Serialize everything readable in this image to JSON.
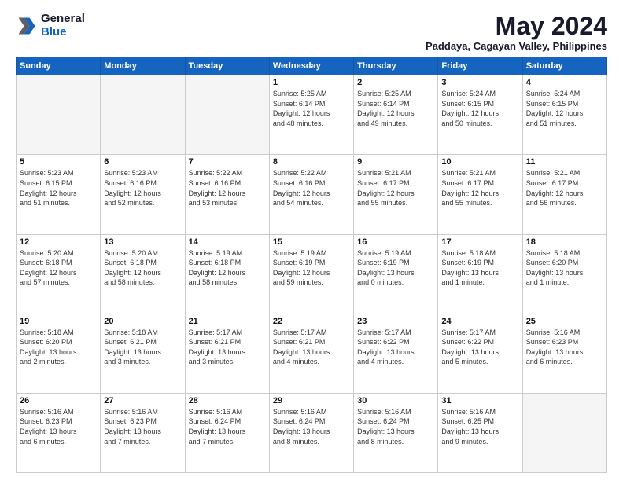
{
  "logo": {
    "general": "General",
    "blue": "Blue"
  },
  "header": {
    "month": "May 2024",
    "location": "Paddaya, Cagayan Valley, Philippines"
  },
  "weekdays": [
    "Sunday",
    "Monday",
    "Tuesday",
    "Wednesday",
    "Thursday",
    "Friday",
    "Saturday"
  ],
  "weeks": [
    [
      {
        "day": "",
        "info": ""
      },
      {
        "day": "",
        "info": ""
      },
      {
        "day": "",
        "info": ""
      },
      {
        "day": "1",
        "info": "Sunrise: 5:25 AM\nSunset: 6:14 PM\nDaylight: 12 hours\nand 48 minutes."
      },
      {
        "day": "2",
        "info": "Sunrise: 5:25 AM\nSunset: 6:14 PM\nDaylight: 12 hours\nand 49 minutes."
      },
      {
        "day": "3",
        "info": "Sunrise: 5:24 AM\nSunset: 6:15 PM\nDaylight: 12 hours\nand 50 minutes."
      },
      {
        "day": "4",
        "info": "Sunrise: 5:24 AM\nSunset: 6:15 PM\nDaylight: 12 hours\nand 51 minutes."
      }
    ],
    [
      {
        "day": "5",
        "info": "Sunrise: 5:23 AM\nSunset: 6:15 PM\nDaylight: 12 hours\nand 51 minutes."
      },
      {
        "day": "6",
        "info": "Sunrise: 5:23 AM\nSunset: 6:16 PM\nDaylight: 12 hours\nand 52 minutes."
      },
      {
        "day": "7",
        "info": "Sunrise: 5:22 AM\nSunset: 6:16 PM\nDaylight: 12 hours\nand 53 minutes."
      },
      {
        "day": "8",
        "info": "Sunrise: 5:22 AM\nSunset: 6:16 PM\nDaylight: 12 hours\nand 54 minutes."
      },
      {
        "day": "9",
        "info": "Sunrise: 5:21 AM\nSunset: 6:17 PM\nDaylight: 12 hours\nand 55 minutes."
      },
      {
        "day": "10",
        "info": "Sunrise: 5:21 AM\nSunset: 6:17 PM\nDaylight: 12 hours\nand 55 minutes."
      },
      {
        "day": "11",
        "info": "Sunrise: 5:21 AM\nSunset: 6:17 PM\nDaylight: 12 hours\nand 56 minutes."
      }
    ],
    [
      {
        "day": "12",
        "info": "Sunrise: 5:20 AM\nSunset: 6:18 PM\nDaylight: 12 hours\nand 57 minutes."
      },
      {
        "day": "13",
        "info": "Sunrise: 5:20 AM\nSunset: 6:18 PM\nDaylight: 12 hours\nand 58 minutes."
      },
      {
        "day": "14",
        "info": "Sunrise: 5:19 AM\nSunset: 6:18 PM\nDaylight: 12 hours\nand 58 minutes."
      },
      {
        "day": "15",
        "info": "Sunrise: 5:19 AM\nSunset: 6:19 PM\nDaylight: 12 hours\nand 59 minutes."
      },
      {
        "day": "16",
        "info": "Sunrise: 5:19 AM\nSunset: 6:19 PM\nDaylight: 13 hours\nand 0 minutes."
      },
      {
        "day": "17",
        "info": "Sunrise: 5:18 AM\nSunset: 6:19 PM\nDaylight: 13 hours\nand 1 minute."
      },
      {
        "day": "18",
        "info": "Sunrise: 5:18 AM\nSunset: 6:20 PM\nDaylight: 13 hours\nand 1 minute."
      }
    ],
    [
      {
        "day": "19",
        "info": "Sunrise: 5:18 AM\nSunset: 6:20 PM\nDaylight: 13 hours\nand 2 minutes."
      },
      {
        "day": "20",
        "info": "Sunrise: 5:18 AM\nSunset: 6:21 PM\nDaylight: 13 hours\nand 3 minutes."
      },
      {
        "day": "21",
        "info": "Sunrise: 5:17 AM\nSunset: 6:21 PM\nDaylight: 13 hours\nand 3 minutes."
      },
      {
        "day": "22",
        "info": "Sunrise: 5:17 AM\nSunset: 6:21 PM\nDaylight: 13 hours\nand 4 minutes."
      },
      {
        "day": "23",
        "info": "Sunrise: 5:17 AM\nSunset: 6:22 PM\nDaylight: 13 hours\nand 4 minutes."
      },
      {
        "day": "24",
        "info": "Sunrise: 5:17 AM\nSunset: 6:22 PM\nDaylight: 13 hours\nand 5 minutes."
      },
      {
        "day": "25",
        "info": "Sunrise: 5:16 AM\nSunset: 6:23 PM\nDaylight: 13 hours\nand 6 minutes."
      }
    ],
    [
      {
        "day": "26",
        "info": "Sunrise: 5:16 AM\nSunset: 6:23 PM\nDaylight: 13 hours\nand 6 minutes."
      },
      {
        "day": "27",
        "info": "Sunrise: 5:16 AM\nSunset: 6:23 PM\nDaylight: 13 hours\nand 7 minutes."
      },
      {
        "day": "28",
        "info": "Sunrise: 5:16 AM\nSunset: 6:24 PM\nDaylight: 13 hours\nand 7 minutes."
      },
      {
        "day": "29",
        "info": "Sunrise: 5:16 AM\nSunset: 6:24 PM\nDaylight: 13 hours\nand 8 minutes."
      },
      {
        "day": "30",
        "info": "Sunrise: 5:16 AM\nSunset: 6:24 PM\nDaylight: 13 hours\nand 8 minutes."
      },
      {
        "day": "31",
        "info": "Sunrise: 5:16 AM\nSunset: 6:25 PM\nDaylight: 13 hours\nand 9 minutes."
      },
      {
        "day": "",
        "info": ""
      }
    ]
  ]
}
